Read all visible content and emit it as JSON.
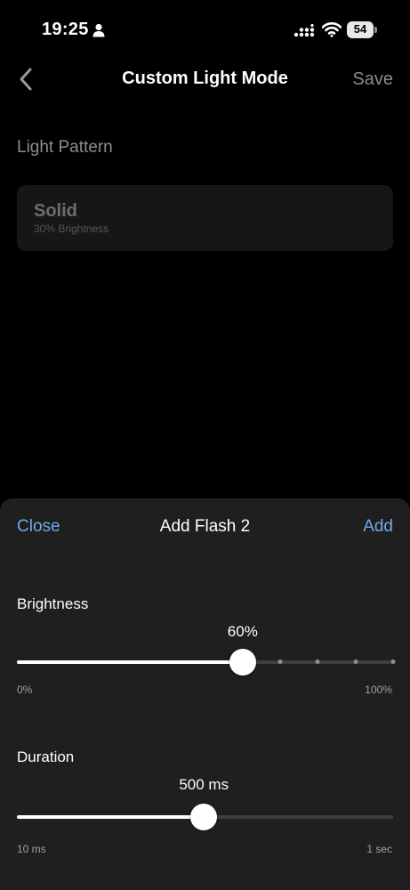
{
  "status_bar": {
    "time": "19:25",
    "battery": "54",
    "icons": [
      "person-icon",
      "signal-icon",
      "wifi-icon",
      "battery-icon"
    ]
  },
  "nav": {
    "back_icon": "chevron-left-icon",
    "title": "Custom Light Mode",
    "save_label": "Save"
  },
  "pattern": {
    "section_label": "Light Pattern",
    "name": "Solid",
    "subtitle": "30% Brightness"
  },
  "sheet": {
    "close_label": "Close",
    "title": "Add Flash 2",
    "add_label": "Add",
    "brightness": {
      "label": "Brightness",
      "value_text": "60%",
      "value": 0.6,
      "min_label": "0%",
      "max_label": "100%",
      "tick_stops": [
        0.7,
        0.8,
        0.9,
        1.0
      ]
    },
    "duration": {
      "label": "Duration",
      "value_text": "500 ms",
      "value": 0.497,
      "min_label": "10 ms",
      "max_label": "1 sec"
    }
  },
  "colors": {
    "accent": "#71a9e8",
    "background": "#000000",
    "sheet": "#1f1f1f"
  }
}
